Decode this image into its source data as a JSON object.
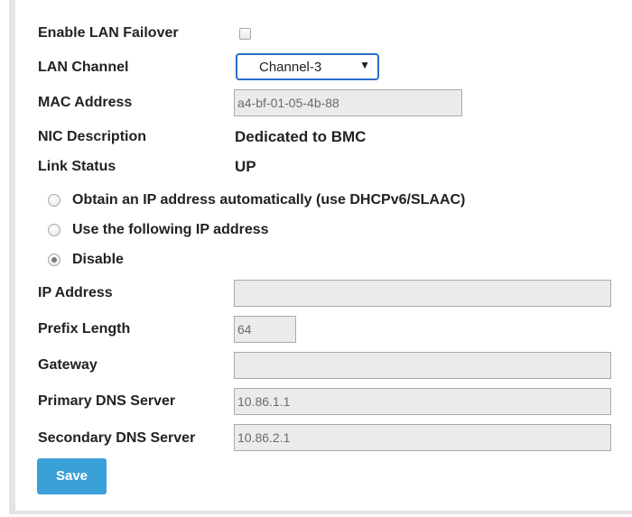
{
  "form": {
    "enable_lan_failover_label": "Enable LAN Failover",
    "enable_lan_failover_checked": false,
    "lan_channel_label": "LAN Channel",
    "lan_channel_value": "Channel-3",
    "mac_address_label": "MAC Address",
    "mac_address_value": "a4-bf-01-05-4b-88",
    "nic_description_label": "NIC Description",
    "nic_description_value": "Dedicated to BMC",
    "link_status_label": "Link Status",
    "link_status_value": "UP",
    "ip_options": [
      {
        "label": "Obtain an IP address automatically (use DHCPv6/SLAAC)",
        "checked": false
      },
      {
        "label": "Use the following IP address",
        "checked": false
      },
      {
        "label": "Disable",
        "checked": true
      }
    ],
    "ip_address_label": "IP Address",
    "ip_address_value": "",
    "prefix_length_label": "Prefix Length",
    "prefix_length_value": "64",
    "gateway_label": "Gateway",
    "gateway_value": "",
    "primary_dns_label": "Primary DNS Server",
    "primary_dns_value": "10.86.1.1",
    "secondary_dns_label": "Secondary DNS Server",
    "secondary_dns_value": "10.86.2.1",
    "save_label": "Save"
  },
  "icons": {
    "dropdown": "caret-down-icon"
  },
  "colors": {
    "save_button": "#3aa0d8",
    "select_border": "#2a6fc9",
    "input_background": "#ebebeb"
  }
}
